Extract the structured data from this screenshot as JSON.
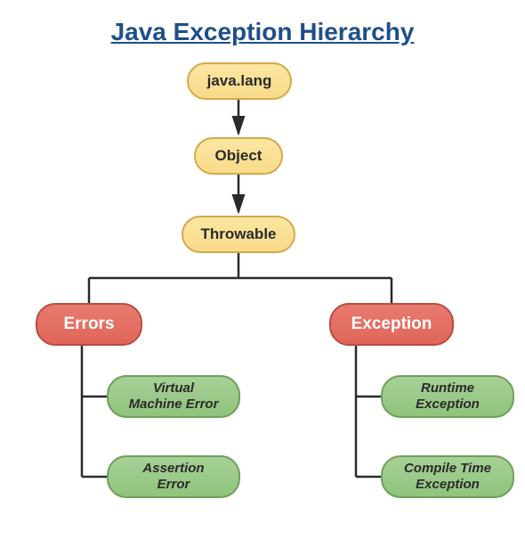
{
  "title": "Java Exception Hierarchy ",
  "nodes": {
    "root": "java.lang",
    "object": "Object",
    "throwable": "Throwable",
    "errors": "Errors",
    "exception": "Exception",
    "vm_error": "Virtual Machine Error",
    "assertion_error": "Assertion Error",
    "runtime_ex": "Runtime Exception",
    "compile_ex": "Compile Time Exception"
  },
  "colors": {
    "title": "#1e4f8a",
    "yellow_fill": "#f9db8a",
    "yellow_border": "#d4a94a",
    "red_fill": "#e06659",
    "red_border": "#b84c42",
    "green_fill": "#8fc47c",
    "green_border": "#6da05a"
  },
  "diagram": {
    "type": "hierarchy",
    "edges": [
      [
        "java.lang",
        "Object"
      ],
      [
        "Object",
        "Throwable"
      ],
      [
        "Throwable",
        "Errors"
      ],
      [
        "Throwable",
        "Exception"
      ],
      [
        "Errors",
        "Virtual Machine Error"
      ],
      [
        "Errors",
        "Assertion Error"
      ],
      [
        "Exception",
        "Runtime Exception"
      ],
      [
        "Exception",
        "Compile Time Exception"
      ]
    ]
  }
}
